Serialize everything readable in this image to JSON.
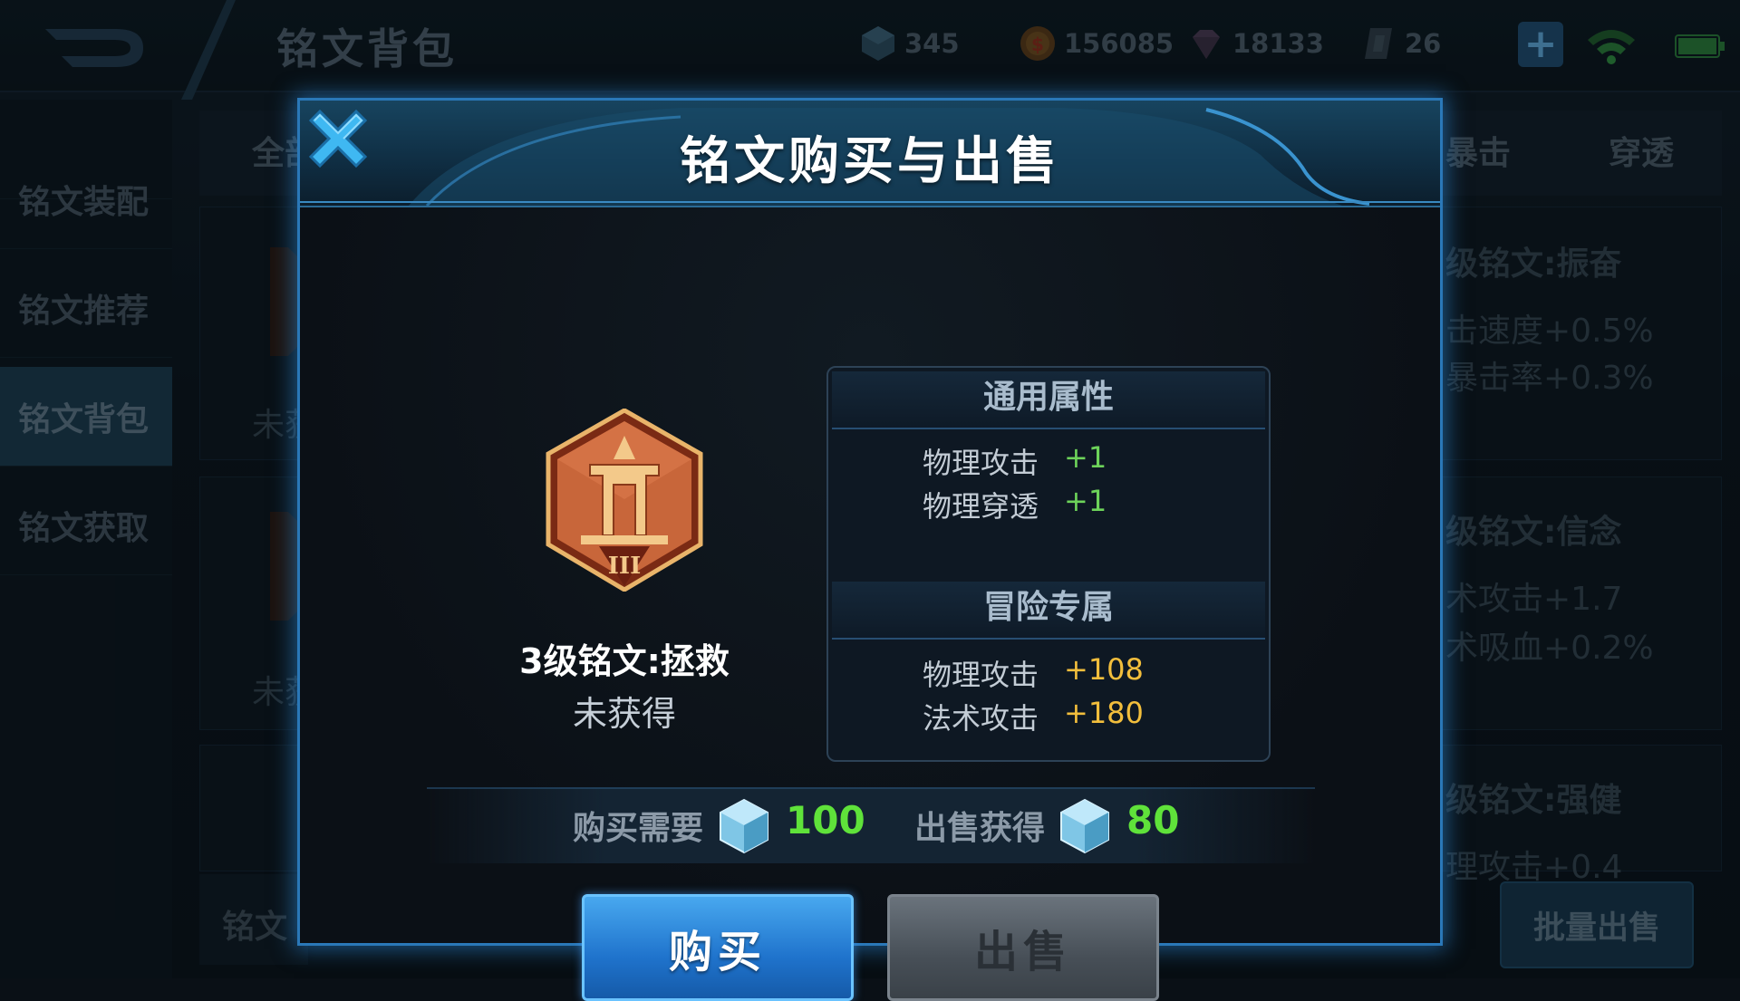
{
  "header": {
    "page_title": "铭文背包",
    "resources": [
      {
        "icon": "diamond-currency-icon",
        "value": "345"
      },
      {
        "icon": "gold-coin-icon",
        "value": "156085"
      },
      {
        "icon": "gem-fragment-icon",
        "value": "18133"
      },
      {
        "icon": "inscription-fragment-icon",
        "value": "26"
      }
    ]
  },
  "sidebar": {
    "items": [
      {
        "label": "铭文装配"
      },
      {
        "label": "铭文推荐"
      },
      {
        "label": "铭文背包",
        "active": true
      },
      {
        "label": "铭文获取"
      }
    ]
  },
  "background": {
    "tabs_visible": [
      "全部",
      "暴击",
      "穿透"
    ],
    "right_cards": [
      {
        "title": "级铭文:振奋",
        "line1": "击速度+0.5%",
        "line2": "暴击率+0.3%"
      },
      {
        "title": "级铭文:信念",
        "line1": "术攻击+1.7",
        "line2": "术吸血+0.2%"
      },
      {
        "title": "级铭文:强健",
        "line1": "理攻击+0.4",
        "line2": ""
      }
    ],
    "left_partial": [
      "未获",
      "未获",
      "铭文"
    ],
    "batch_sell_label": "批量出售"
  },
  "dialog": {
    "title": "铭文购买与出售",
    "item": {
      "name": "3级铭文:拯救",
      "status": "未获得",
      "level_numeral": "III",
      "colors": {
        "frame": "#c8663a",
        "accent": "#f3c98a"
      }
    },
    "general_section": {
      "title": "通用属性",
      "attributes": [
        {
          "name": "物理攻击",
          "value": "+1"
        },
        {
          "name": "物理穿透",
          "value": "+1"
        }
      ]
    },
    "adventure_section": {
      "title": "冒险专属",
      "attributes": [
        {
          "name": "物理攻击",
          "value": "+108"
        },
        {
          "name": "法术攻击",
          "value": "+180"
        }
      ]
    },
    "buy_price": {
      "label": "购买需要",
      "currency_icon": "diamond-icon",
      "value": "100"
    },
    "sell_price": {
      "label": "出售获得",
      "currency_icon": "diamond-icon",
      "value": "80"
    },
    "buttons": {
      "buy": "购买",
      "sell": "出售"
    },
    "colors": {
      "positive": "#6dd35a",
      "gold": "#f2be3c",
      "price": "#5fe23a",
      "buy_button": "#1f73cc"
    }
  }
}
